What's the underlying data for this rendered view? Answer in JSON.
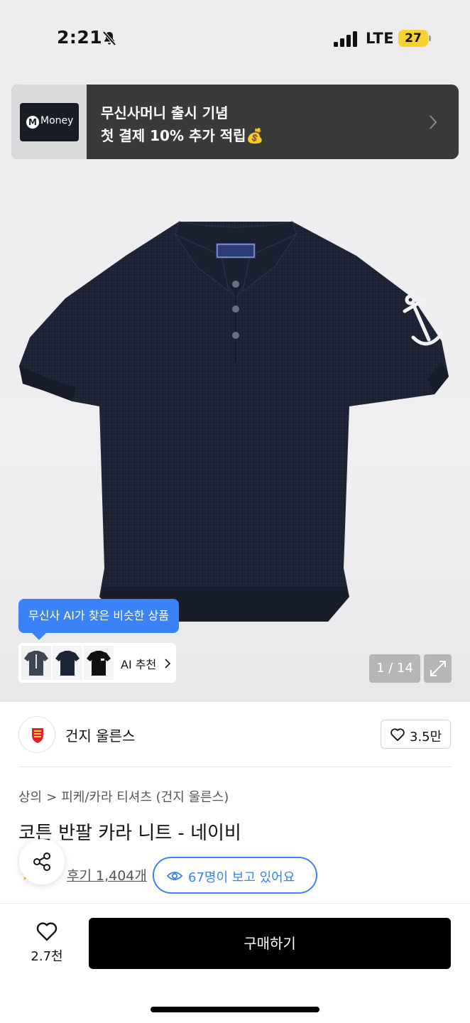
{
  "status_bar": {
    "time": "2:21",
    "network": "LTE",
    "battery": "27",
    "battery_color": "#f7d12e"
  },
  "banner": {
    "logo_text": "Money",
    "line1": "무신사머니 출시 기념",
    "line2": "첫 결제 10% 추가 적립💰"
  },
  "gallery": {
    "ai_tooltip": "무신사 AI가 찾은 비슷한 상품",
    "ai_recommend_label": "AI 추천",
    "page_indicator": "1 / 14"
  },
  "brand": {
    "name": "건지 울른스",
    "likes": "3.5만"
  },
  "product": {
    "breadcrumb": [
      "상의",
      "피케/카라 티셔츠 (건지 울른스)"
    ],
    "title": "코튼 반팔 카라 니트 - 네이비",
    "reviews": "후기 1,404개",
    "viewing": "67명이 보고 있어요"
  },
  "bottom_bar": {
    "favorite_count": "2.7천",
    "buy_label": "구매하기"
  },
  "colors": {
    "accent": "#3b82f6",
    "buy_button": "#000000",
    "shirt": "#1c2233"
  }
}
